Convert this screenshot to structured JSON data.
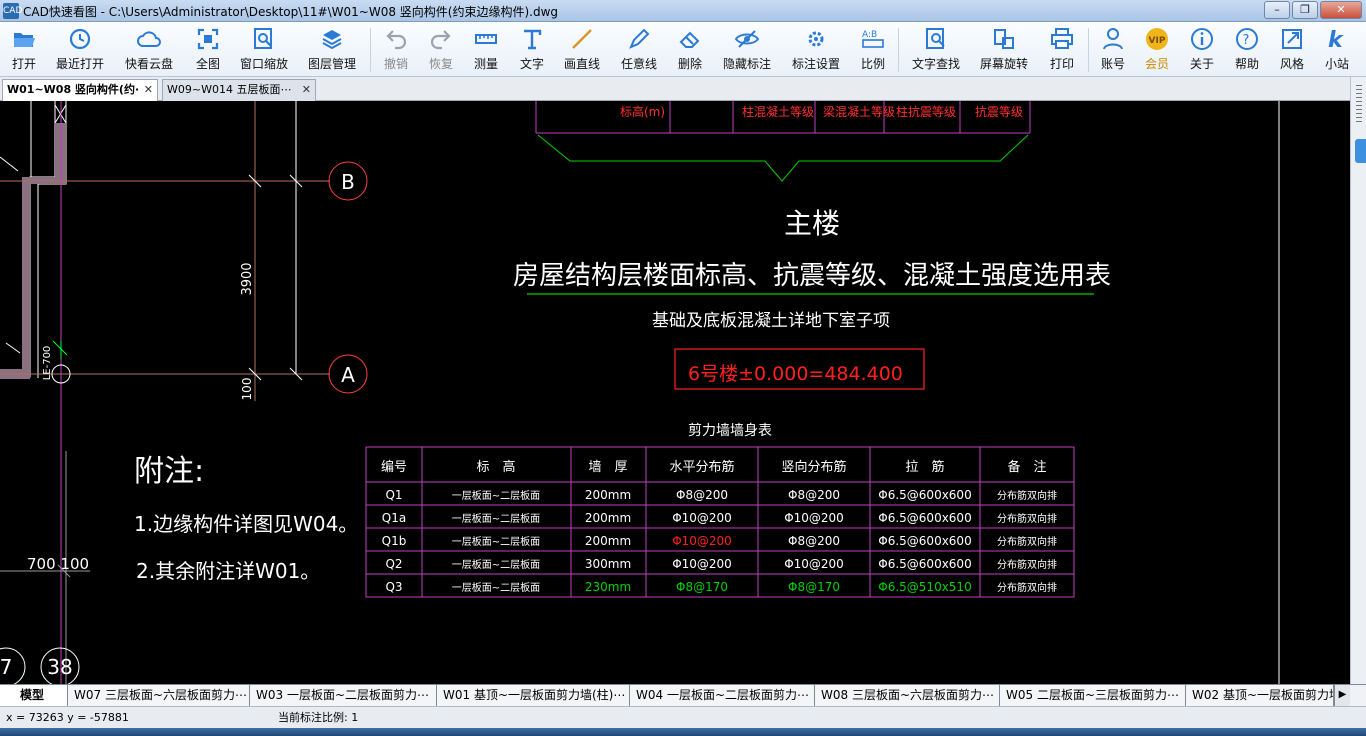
{
  "window": {
    "app_icon": "CAD",
    "title": "CAD快速看图 - C:\\Users\\Administrator\\Desktop\\11#\\W01~W08 竖向构件(约束边缘构件).dwg"
  },
  "toolbar": {
    "items": [
      {
        "label": "打开",
        "icon": "folder-open-icon"
      },
      {
        "label": "最近打开",
        "icon": "recent-icon"
      },
      {
        "label": "快看云盘",
        "icon": "cloud-icon"
      },
      {
        "label": "全图",
        "icon": "fullview-icon"
      },
      {
        "label": "窗口缩放",
        "icon": "zoom-window-icon"
      },
      {
        "label": "图层管理",
        "icon": "layers-icon"
      },
      {
        "label": "撤销",
        "icon": "undo-icon"
      },
      {
        "label": "恢复",
        "icon": "redo-icon"
      },
      {
        "label": "测量",
        "icon": "measure-icon"
      },
      {
        "label": "文字",
        "icon": "text-icon"
      },
      {
        "label": "画直线",
        "icon": "line-icon"
      },
      {
        "label": "任意线",
        "icon": "pen-icon"
      },
      {
        "label": "删除",
        "icon": "eraser-icon"
      },
      {
        "label": "隐藏标注",
        "icon": "eye-hide-icon"
      },
      {
        "label": "标注设置",
        "icon": "annotation-settings-icon"
      },
      {
        "label": "比例",
        "icon": "scale-icon"
      },
      {
        "label": "文字查找",
        "icon": "text-search-icon"
      },
      {
        "label": "屏幕旋转",
        "icon": "rotate-screen-icon"
      },
      {
        "label": "打印",
        "icon": "printer-icon"
      },
      {
        "label": "账号",
        "icon": "user-icon"
      },
      {
        "label": "会员",
        "icon": "vip-icon"
      },
      {
        "label": "关于",
        "icon": "info-icon"
      },
      {
        "label": "帮助",
        "icon": "help-icon"
      },
      {
        "label": "风格",
        "icon": "style-icon"
      },
      {
        "label": "小站",
        "icon": "site-icon"
      }
    ],
    "disabled": [
      "撤销",
      "恢复"
    ]
  },
  "doc_tabs": [
    {
      "label": "W01~W08 竖向构件(约·",
      "active": true
    },
    {
      "label": "W09~W014  五层板面⋯",
      "active": false
    }
  ],
  "drawing": {
    "top_table_cells": [
      "标高(m)",
      "柱混凝土等级",
      "梁混凝土等级",
      "柱抗震等级",
      "抗震等级"
    ],
    "grid_labels": {
      "b": "B",
      "a": "A",
      "c7": "7",
      "c38": "38"
    },
    "dims": {
      "d3900": "3900",
      "d100": "100",
      "d700_100": "700 100",
      "col_label": "LE-700"
    },
    "main_building": "主楼",
    "table_title": "房屋结构层楼面标高、抗震等级、混凝土强度选用表",
    "foundation_note": "基础及底板混凝土详地下室子项",
    "elevation_box": "6号楼±0.000=484.400",
    "notes": {
      "heading": "附注:",
      "item1": "1.边缘构件详图见W04。",
      "item2": "2.其余附注详W01。"
    },
    "wall_table": {
      "title": "剪力墙墙身表",
      "headers": [
        "编号",
        "标　高",
        "墙　厚",
        "水平分布筋",
        "竖向分布筋",
        "拉　筋",
        "备　注"
      ],
      "rows": [
        [
          "Q1",
          "一层板面~二层板面",
          "200mm",
          "Φ8@200",
          "Φ8@200",
          "Φ6.5@600x600",
          "分布筋双向排"
        ],
        [
          "Q1a",
          "一层板面~二层板面",
          "200mm",
          "Φ10@200",
          "Φ10@200",
          "Φ6.5@600x600",
          "分布筋双向排"
        ],
        [
          "Q1b",
          "一层板面~二层板面",
          "200mm",
          "Φ10@200",
          "Φ8@200",
          "Φ6.5@600x600",
          "分布筋双向排"
        ],
        [
          "Q2",
          "一层板面~二层板面",
          "300mm",
          "Φ10@200",
          "Φ10@200",
          "Φ6.5@600x600",
          "分布筋双向排"
        ],
        [
          "Q3",
          "一层板面~二层板面",
          "230mm",
          "Φ8@170",
          "Φ8@170",
          "Φ6.5@510x510",
          "分布筋双向排"
        ]
      ],
      "highlight": {
        "row2_col3": "red",
        "row4_green_cols": [
          2,
          3,
          4,
          5
        ]
      }
    },
    "colors": {
      "magenta": "#c040c0",
      "green": "#00d000",
      "red": "#ff2020",
      "white": "#ffffff",
      "brown": "#b07060"
    }
  },
  "layout_tabs": [
    "模型",
    "W07 三层板面~六层板面剪力⋯",
    "W03 一层板面~二层板面剪力⋯",
    "W01 基顶~一层板面剪力墙(柱)⋯",
    "W04 一层板面~二层板面剪力⋯",
    "W08 三层板面~六层板面剪力⋯",
    "W05 二层板面~三层板面剪力⋯",
    "W02 基顶~一层板面剪力墙"
  ],
  "status": {
    "coord": "x = 73263  y = -57881",
    "scale": "当前标注比例: 1"
  }
}
